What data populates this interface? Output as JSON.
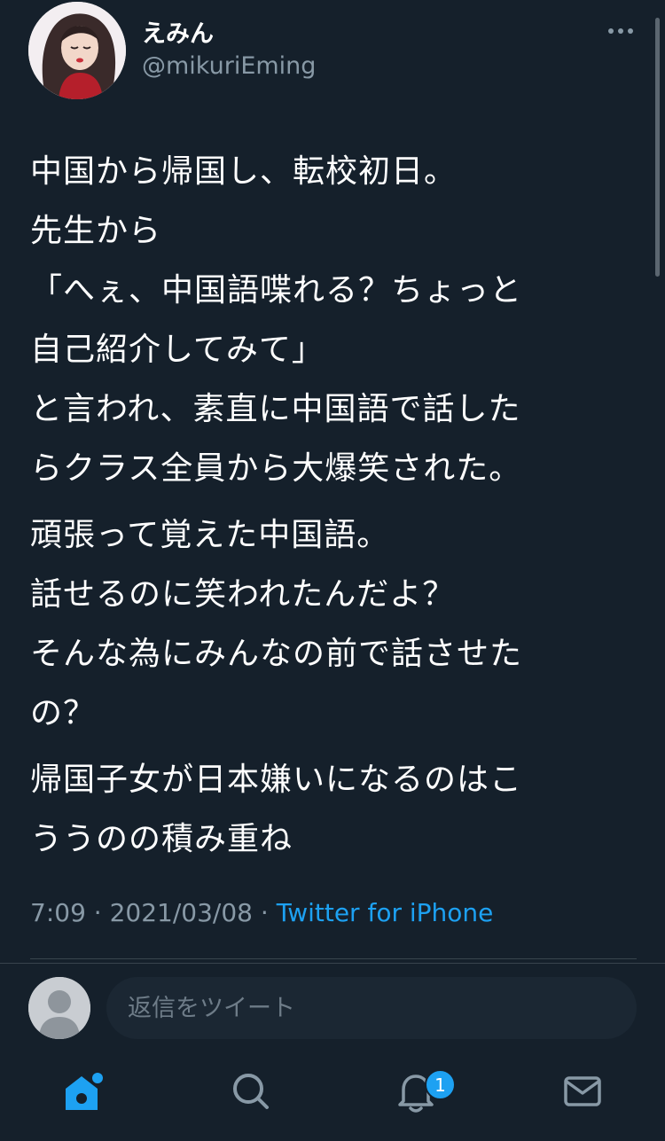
{
  "tweet": {
    "author": {
      "display_name": "えみん",
      "handle": "@mikuriEming"
    },
    "paragraphs": [
      "中国から帰国し、転校初日。\n先生から\n「へぇ、中国語喋れる？ちょっと\n自己紹介してみて」\nと言われ、素直に中国語で話した\nらクラス全員から大爆笑された。",
      "頑張って覚えた中国語。\n話せるのに笑われたんだよ？\nそんな為にみんなの前で話させた\nの？",
      "帰国子女が日本嫌いになるのはこ\nううのの積み重ね"
    ],
    "time": "7:09",
    "date": "2021/03/08",
    "separator": "·",
    "source": "Twitter for iPhone"
  },
  "reply": {
    "placeholder": "返信をツイート"
  },
  "tabbar": {
    "tabs": [
      {
        "icon": "home-icon"
      },
      {
        "icon": "search-icon"
      },
      {
        "icon": "bell-icon",
        "badge": "1"
      },
      {
        "icon": "mail-icon"
      }
    ]
  },
  "colors": {
    "background": "#15202b",
    "accent": "#1da1f2",
    "secondary_text": "#8899a6"
  }
}
